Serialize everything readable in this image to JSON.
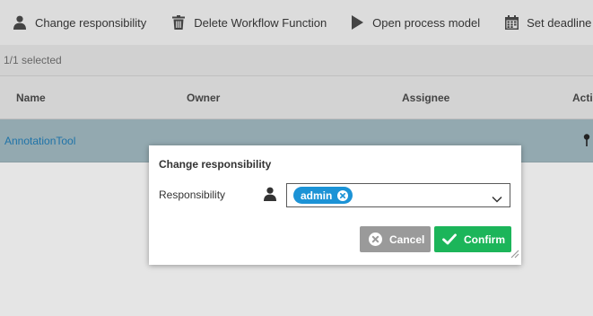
{
  "toolbar": {
    "items": [
      {
        "label": "Change responsibility",
        "icon": "user-icon"
      },
      {
        "label": "Delete Workflow Function",
        "icon": "trash-icon"
      },
      {
        "label": "Open process model",
        "icon": "play-icon"
      },
      {
        "label": "Set deadline",
        "icon": "calendar-icon"
      }
    ]
  },
  "selection": {
    "text": "1/1 selected"
  },
  "table": {
    "headers": [
      "Name",
      "Owner",
      "Assignee",
      "Acti"
    ],
    "rows": [
      {
        "name": "AnnotationTool",
        "owner": "",
        "assignee": "",
        "action_icon": "pin-icon"
      }
    ]
  },
  "dialog": {
    "title": "Change responsibility",
    "field_label": "Responsibility",
    "selected_tags": [
      "admin"
    ],
    "cancel_label": "Cancel",
    "confirm_label": "Confirm"
  },
  "colors": {
    "accent": "#1c93d6",
    "confirm": "#1cb55a",
    "cancel": "#9a9a9a",
    "selected_row": "#93a9b0",
    "link": "#1f73a8"
  }
}
